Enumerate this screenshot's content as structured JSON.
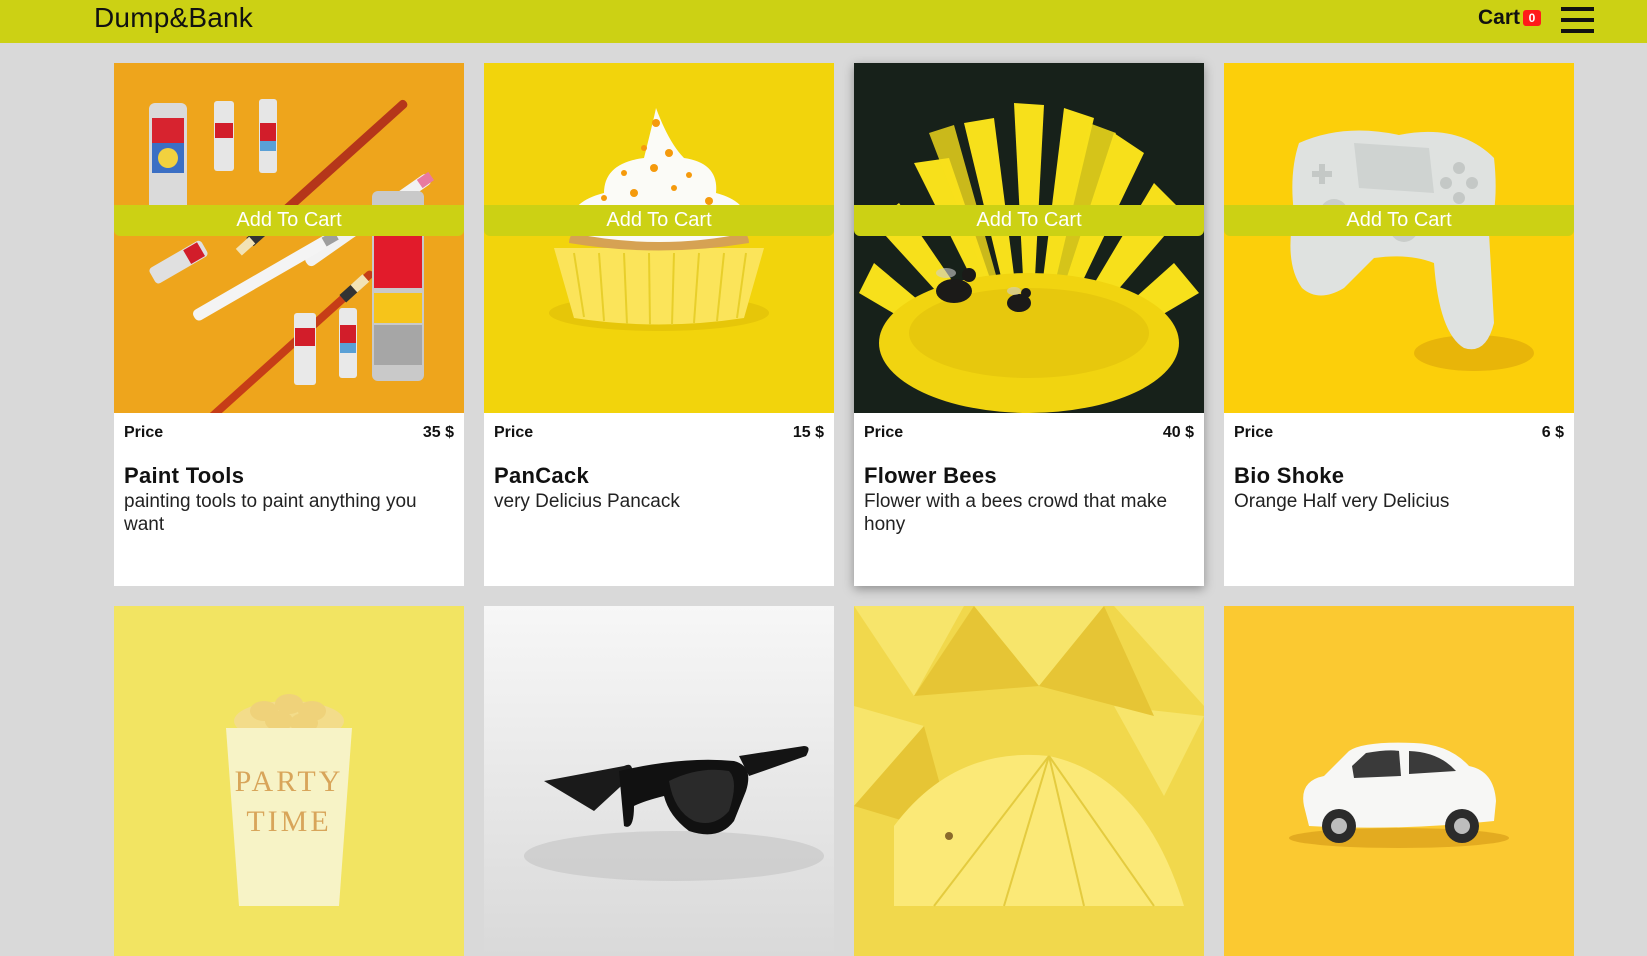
{
  "header": {
    "brand": "Dump&Bank",
    "cart_label": "Cart",
    "cart_count": "0",
    "menu_icon": "hamburger-menu-icon"
  },
  "colors": {
    "accent": "#ccd114",
    "background": "#d9d9d9",
    "badge": "#ff1a1a"
  },
  "products": [
    {
      "price_label": "Price",
      "price": "35 $",
      "title": "Paint Tools",
      "description": "painting tools to paint anything you want",
      "button": "Add To Cart",
      "image": "paint-tools-image"
    },
    {
      "price_label": "Price",
      "price": "15 $",
      "title": "PanCack",
      "description": "very Delicius Pancack",
      "button": "Add To Cart",
      "image": "cupcake-image"
    },
    {
      "price_label": "Price",
      "price": "40 $",
      "title": "Flower Bees",
      "description": "Flower with a bees crowd that make hony",
      "button": "Add To Cart",
      "image": "flower-bees-image"
    },
    {
      "price_label": "Price",
      "price": "6 $",
      "title": "Bio Shoke",
      "description": "Orange Half very Delicius",
      "button": "Add To Cart",
      "image": "controller-image"
    }
  ],
  "products_row2": [
    {
      "image": "party-cup-image",
      "cup_text": "PARTY TIME"
    },
    {
      "image": "sunglasses-image"
    },
    {
      "image": "umbrellas-image"
    },
    {
      "image": "toy-car-image"
    }
  ]
}
